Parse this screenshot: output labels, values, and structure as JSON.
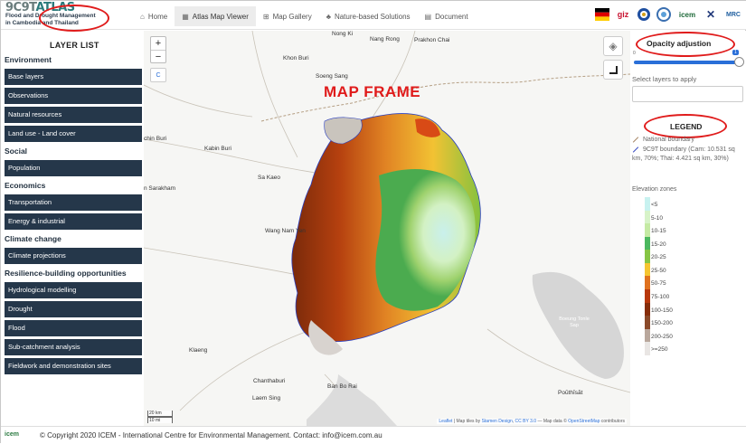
{
  "app": {
    "logo_title": "9C9T",
    "logo_title_suffix": "ATLAS",
    "logo_subtitle_1": "Flood and Drought Management",
    "logo_subtitle_2": "in Cambodia and Thailand"
  },
  "nav": [
    {
      "label": "Home",
      "icon": "home-icon",
      "glyph": "⌂"
    },
    {
      "label": "Atlas Map Viewer",
      "icon": "map-icon",
      "glyph": "▦",
      "active": true
    },
    {
      "label": "Map Gallery",
      "icon": "map-icon",
      "glyph": "⊞"
    },
    {
      "label": "Nature-based Solutions",
      "icon": "bell-icon",
      "glyph": "♣"
    },
    {
      "label": "Document",
      "icon": "document-icon",
      "glyph": "▤"
    }
  ],
  "partners": [
    {
      "name": "germany-flag-logo"
    },
    {
      "name": "giz-logo",
      "text": "giz"
    },
    {
      "name": "mrc-seal-logo"
    },
    {
      "name": "circle-logo"
    },
    {
      "name": "icem-logo",
      "text": "icem"
    },
    {
      "name": "x-logo",
      "text": "✕"
    },
    {
      "name": "mrc-logo",
      "text": "MRC"
    }
  ],
  "sidebar": {
    "annotation": "LAYER LIST",
    "sections": [
      {
        "title": "Environment",
        "items": [
          "Base layers",
          "Observations",
          "Natural resources",
          "Land use - Land cover"
        ]
      },
      {
        "title": "Social",
        "items": [
          "Population"
        ]
      },
      {
        "title": "Economics",
        "items": [
          "Transportation",
          "Energy & industrial"
        ]
      },
      {
        "title": "Climate change",
        "items": [
          "Climate projections"
        ]
      },
      {
        "title": "Resilience-building opportunities",
        "items": [
          "Hydrological modelling",
          "Drought",
          "Flood",
          "Sub-catchment analysis",
          "Fieldwork and demonstration sites"
        ]
      }
    ]
  },
  "map": {
    "annotation": "MAP FRAME",
    "zoom_in": "+",
    "zoom_out": "−",
    "small_ctrl": "C",
    "places": [
      {
        "name": "Nong Ki"
      },
      {
        "name": "Nang Rong"
      },
      {
        "name": "Prakhon Chai"
      },
      {
        "name": "Khon Buri"
      },
      {
        "name": "Soeng Sang"
      },
      {
        "name": "chin Buri"
      },
      {
        "name": "Kabin Buri"
      },
      {
        "name": "Sa Kaeo"
      },
      {
        "name": "n Sarakham"
      },
      {
        "name": "Wang Nam Yen"
      },
      {
        "name": "Klaeng"
      },
      {
        "name": "Chanthaburi"
      },
      {
        "name": "Laem Sing"
      },
      {
        "name": "Ban Bo Rai"
      },
      {
        "name": "Poŭthĭsăt"
      },
      {
        "name": "Boeung Tonle Sap"
      }
    ],
    "scale_km": "20 km",
    "scale_mi": "10 mi",
    "attribution_leaflet": "Leaflet",
    "attribution_mid": " | Map tiles by ",
    "attribution_stamen": "Stamen Design",
    "attribution_cc": "CC BY 3.0",
    "attribution_data": " — Map data © ",
    "attribution_osm": "OpenStreetMap",
    "attribution_end": " contributors"
  },
  "right_panel": {
    "opacity_title": "Opacity adjustion",
    "opacity_min": "0",
    "opacity_max": "1",
    "opacity_value": 1.0,
    "select_label": "Select layers to apply",
    "legend_title": "LEGEND",
    "legend_items": [
      {
        "label": "National boundary",
        "color": "#a07d5a"
      },
      {
        "label": "9C9T boundary (Cam: 10.531 sq km, 70%; Thai: 4.421 sq km, 30%)",
        "color": "#2a3fbf"
      }
    ],
    "elevation_title": "Elevation zones",
    "elevation_zones": [
      {
        "label": "<5",
        "color": "#c8f2f0"
      },
      {
        "label": "5-10",
        "color": "#d7f3c8"
      },
      {
        "label": "10-15",
        "color": "#c5eaa4"
      },
      {
        "label": "15-20",
        "color": "#4cb860"
      },
      {
        "label": "20-25",
        "color": "#86c544"
      },
      {
        "label": "25-50",
        "color": "#f5c531"
      },
      {
        "label": "50-75",
        "color": "#e0721f"
      },
      {
        "label": "75-100",
        "color": "#b8380c"
      },
      {
        "label": "100-150",
        "color": "#862d0a"
      },
      {
        "label": "150-200",
        "color": "#8a4a2a"
      },
      {
        "label": "200-250",
        "color": "#b9a79c"
      },
      {
        "label": ">=250",
        "color": "#e9e6e4"
      }
    ]
  },
  "footer": {
    "logo": "icem",
    "text": "© Copyright 2020 ICEM - International Centre for Environmental Management. Contact: info@icem.com.au"
  }
}
